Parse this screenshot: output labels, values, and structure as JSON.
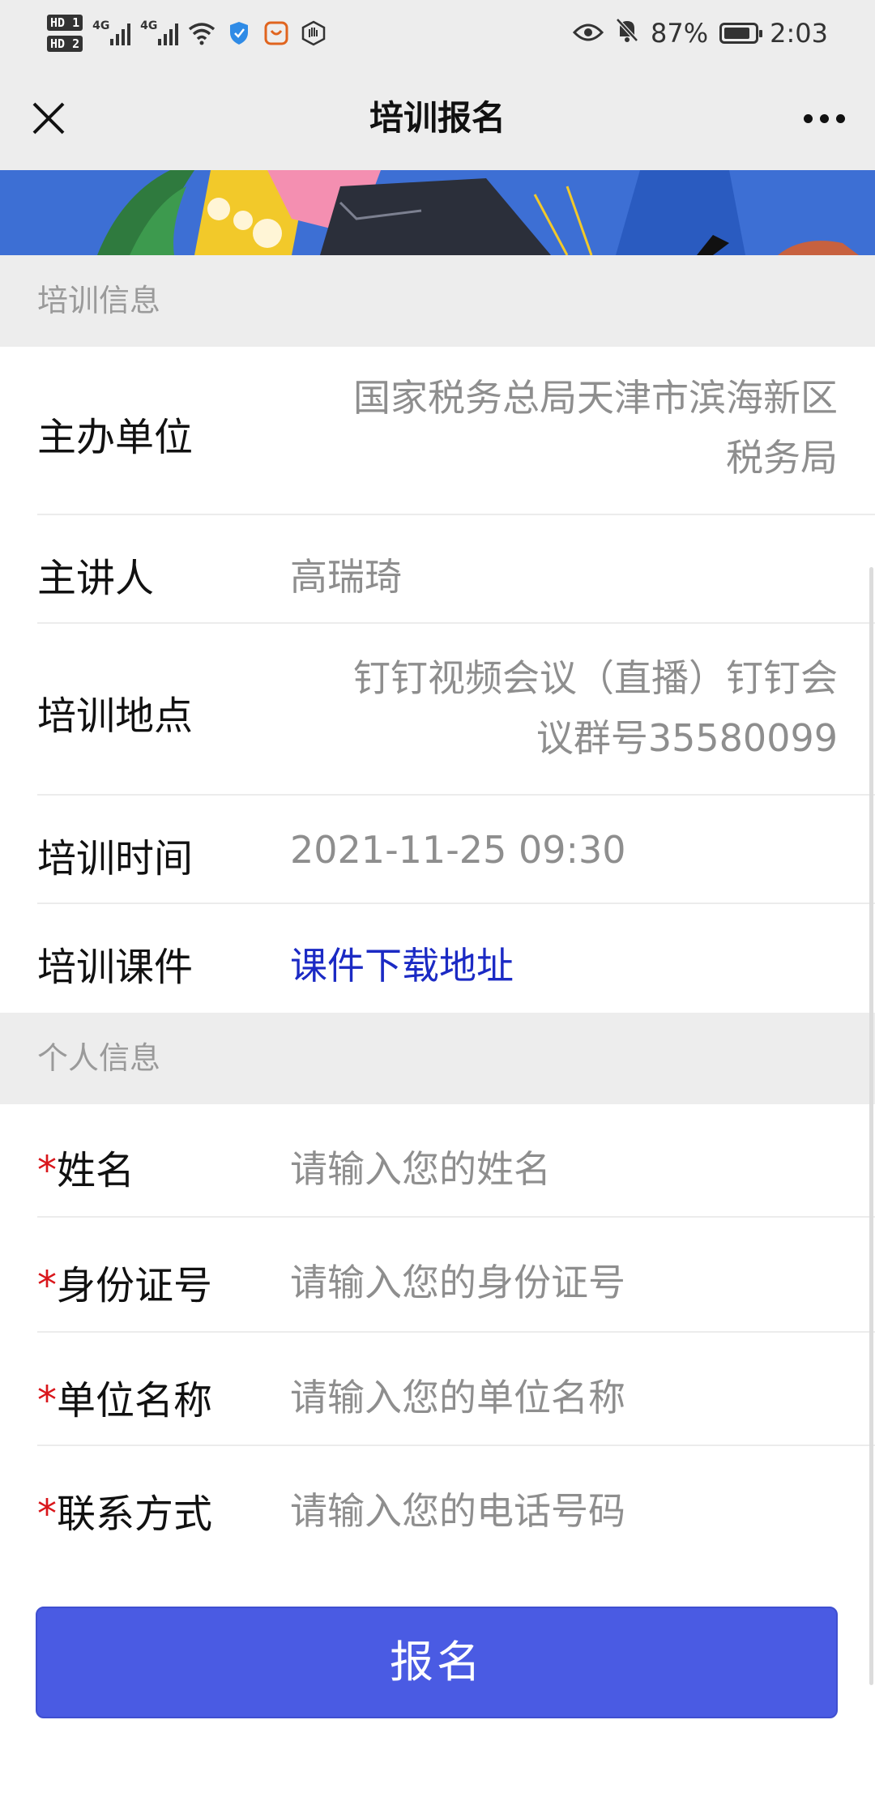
{
  "status_bar": {
    "hd1": "HD 1",
    "hd2": "HD 2",
    "net1": "4G",
    "net2": "4G",
    "battery_percent": "87%",
    "battery_level": 0.87,
    "time": "2:03"
  },
  "nav": {
    "title": "培训报名"
  },
  "training_info": {
    "header": "培训信息",
    "organizer_label": "主办单位",
    "organizer_line1": "国家税务总局天津市滨海新区",
    "organizer_line2": "税务局",
    "speaker_label": "主讲人",
    "speaker_value": "高瑞琦",
    "location_label": "培训地点",
    "location_line1": "钉钉视频会议（直播）钉钉会",
    "location_line2": "议群号35580099",
    "time_label": "培训时间",
    "time_value": "2021-11-25 09:30",
    "courseware_label": "培训课件",
    "courseware_link": "课件下载地址"
  },
  "personal_info": {
    "header": "个人信息",
    "required_mark": "*",
    "name_label": "姓名",
    "name_placeholder": "请输入您的姓名",
    "id_label": "身份证号",
    "id_placeholder": "请输入您的身份证号",
    "unit_label": "单位名称",
    "unit_placeholder": "请输入您的单位名称",
    "contact_label": "联系方式",
    "contact_placeholder": "请输入您的电话号码"
  },
  "submit": {
    "label": "报名"
  },
  "colors": {
    "accent": "#4a5be3",
    "link": "#1b2ac4",
    "required": "#d9161b"
  }
}
